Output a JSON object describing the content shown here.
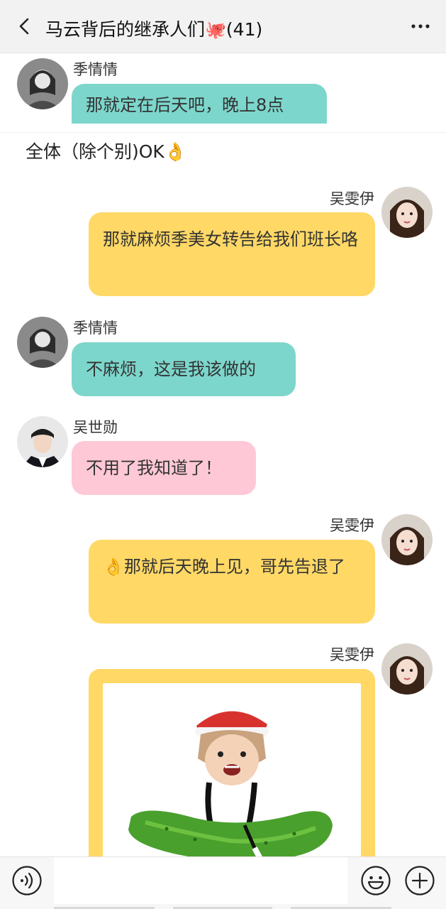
{
  "header": {
    "title": "马云背后的继承人们",
    "title_emoji": "🐙",
    "member_count": "(41)"
  },
  "messages": [
    {
      "sender": "季情情",
      "text": "那就定在后天吧，晚上8点"
    },
    {
      "system_text": "全体（除个别)OK👌"
    },
    {
      "sender": "吴雯伊",
      "text": "那就麻烦季美女转告给我们班长咯"
    },
    {
      "sender": "季情情",
      "text": "不麻烦，这是我该做的"
    },
    {
      "sender": "吴世勋",
      "text": "不用了我知道了！"
    },
    {
      "sender": "吴雯伊",
      "text": "👌那就后天晚上见，哥先告退了"
    },
    {
      "sender": "吴雯伊",
      "sticker": "cucumber-sticker"
    }
  ],
  "colors": {
    "teal_bubble": "#7dd6cc",
    "pink_bubble": "#ffc8d6",
    "yellow_bubble": "#ffd866"
  }
}
